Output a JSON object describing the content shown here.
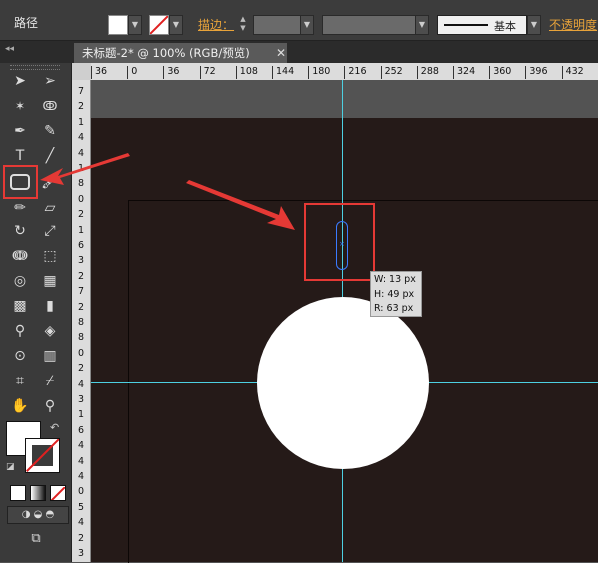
{
  "control_bar": {
    "object_type": "路径",
    "stroke_label": "描边",
    "stroke_colon": "：",
    "stroke_profile": "基本",
    "opacity_label": "不透明度"
  },
  "document": {
    "tab_title": "未标题-2* @ 100% (RGB/预览)",
    "tab_close": "✕"
  },
  "rulers": {
    "horizontal": [
      "36",
      "0",
      "36",
      "72",
      "108",
      "144",
      "180",
      "216",
      "252",
      "288",
      "324",
      "360",
      "396",
      "432"
    ],
    "vertical": [
      "7",
      "2",
      "1",
      "4",
      "4",
      "1",
      "8",
      "0",
      "2",
      "1",
      "6",
      "3",
      "2",
      "7",
      "2",
      "8",
      "8",
      "0",
      "2",
      "4",
      "3",
      "1",
      "6",
      "4",
      "4",
      "4",
      "0",
      "5",
      "4",
      "2",
      "3"
    ]
  },
  "measure_tooltip": {
    "w": "W: 13 px",
    "h": "H: 49 px",
    "r": "R: 63 px"
  },
  "colors": {
    "highlight": "#e53935",
    "guide": "#4dd0e1",
    "selection": "#3b7bff",
    "artboard": "#251a18"
  },
  "tools": [
    "selection-tool",
    "direct-selection-tool",
    "magic-wand-tool",
    "lasso-tool",
    "pen-tool",
    "curvature-tool",
    "type-tool",
    "line-segment-tool",
    "rounded-rectangle-tool",
    "paintbrush-tool",
    "pencil-tool",
    "eraser-tool",
    "rotate-tool",
    "scale-tool",
    "width-tool",
    "free-transform-tool",
    "shape-builder-tool",
    "perspective-grid-tool",
    "mesh-tool",
    "gradient-tool",
    "eyedropper-tool",
    "blend-tool",
    "symbol-sprayer-tool",
    "column-graph-tool",
    "artboard-tool",
    "slice-tool",
    "hand-tool",
    "zoom-tool"
  ]
}
